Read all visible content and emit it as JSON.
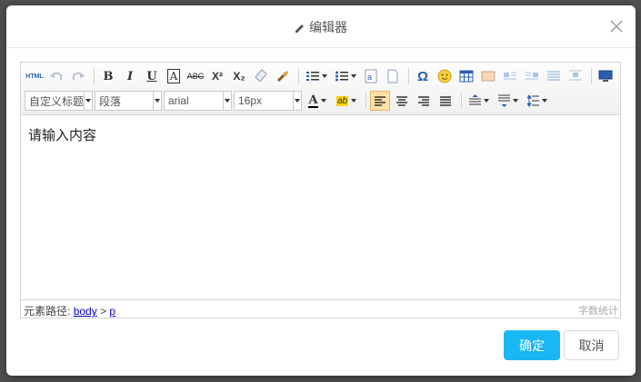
{
  "dialog": {
    "title": "编辑器",
    "ok_label": "确定",
    "cancel_label": "取消"
  },
  "toolbar": {
    "html_label": "HTML",
    "bold": "B",
    "italic": "I",
    "underline": "U",
    "fontborder": "A",
    "strike": "ABC",
    "superscript": "X²",
    "subscript": "X₂",
    "customstyle": "自定义标题",
    "paragraph": "段落",
    "fontfamily": "arial",
    "fontsize": "16px",
    "forecolor": "A",
    "backcolor": "ab",
    "special_char": "Ω"
  },
  "editor": {
    "content": "请输入内容"
  },
  "statusbar": {
    "path_label": "元素路径:",
    "path_body": "body",
    "path_sep": ">",
    "path_p": "p",
    "wordcount_label": "字数统计"
  },
  "colors": {
    "accent": "#1ab7f5",
    "active_btn": "#ffe2a6"
  }
}
